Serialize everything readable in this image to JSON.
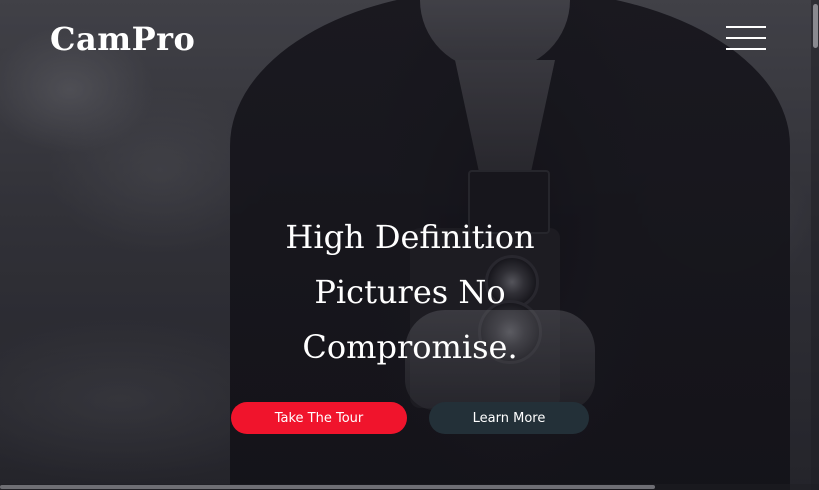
{
  "header": {
    "logo": "CamPro",
    "menu_icon": "hamburger-menu-icon"
  },
  "hero": {
    "headline_lines": [
      "High Definition",
      "Pictures No",
      "Compromise."
    ],
    "primary_button": "Take The Tour",
    "secondary_button": "Learn More",
    "background_image": "man holding twin-lens reflex camera"
  },
  "colors": {
    "primary_button": "#f0142c",
    "secondary_button": "#233038",
    "text": "#ffffff"
  }
}
